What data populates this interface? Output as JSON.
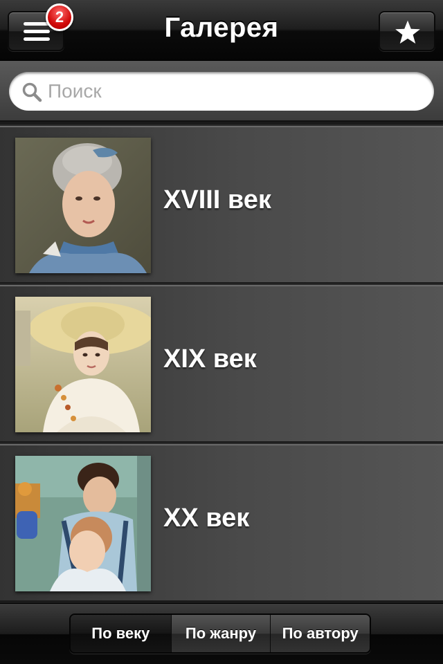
{
  "navbar": {
    "title": "Галерея",
    "menu_badge": "2",
    "left_icon": "menu-icon",
    "right_icon": "star-icon"
  },
  "search": {
    "placeholder": "Поиск",
    "value": "",
    "icon": "search-icon"
  },
  "list": {
    "items": [
      {
        "label": "XVIII век",
        "thumbnail": "portrait-18th-century"
      },
      {
        "label": "XIX век",
        "thumbnail": "portrait-19th-century"
      },
      {
        "label": "XX век",
        "thumbnail": "portrait-20th-century"
      }
    ]
  },
  "tabs": {
    "items": [
      {
        "label": "По веку",
        "active": true
      },
      {
        "label": "По жанру",
        "active": false
      },
      {
        "label": "По автору",
        "active": false
      }
    ]
  },
  "colors": {
    "badge": "#d10a0a",
    "text": "#ffffff"
  }
}
